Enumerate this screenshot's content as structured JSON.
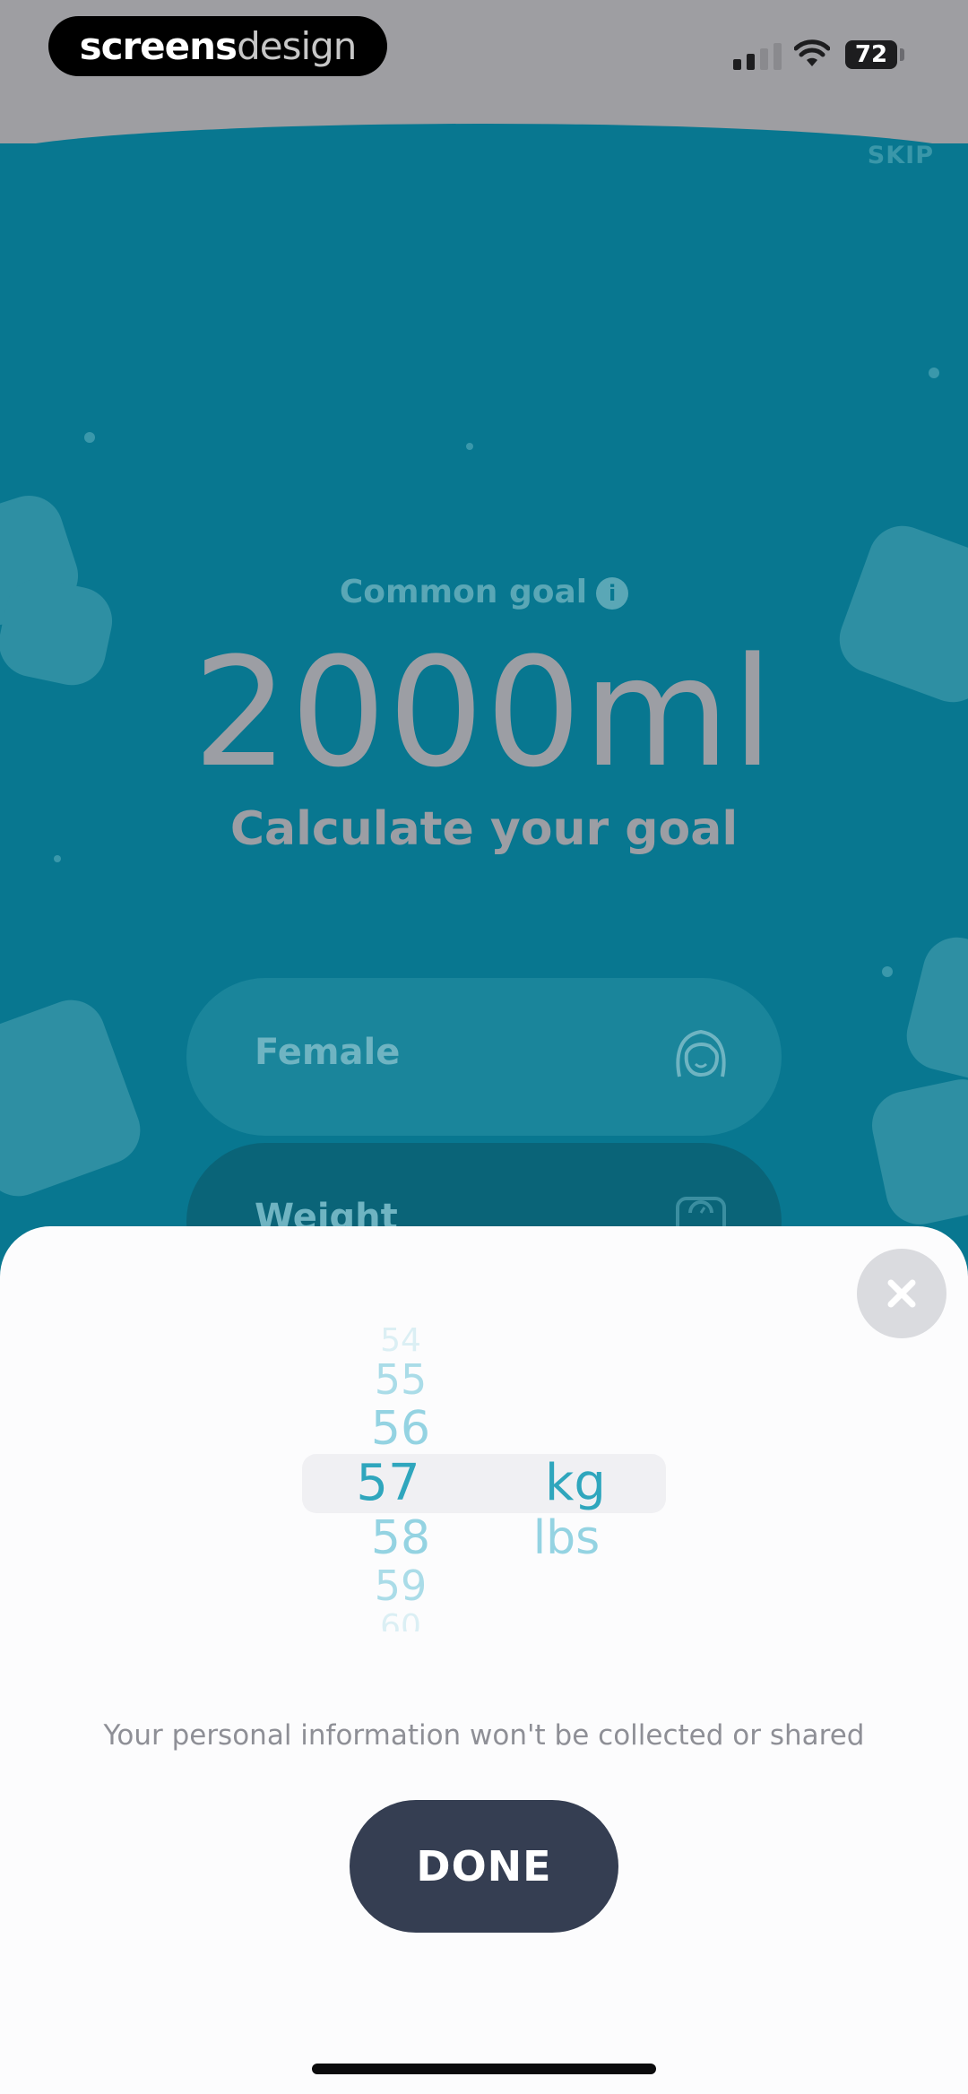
{
  "status_bar": {
    "brand_primary": "screens",
    "brand_secondary": "design",
    "battery": "72"
  },
  "header": {
    "skip_label": "SKIP"
  },
  "goal": {
    "common_label": "Common goal",
    "info_symbol": "i",
    "amount": "2000ml",
    "calculate_label": "Calculate your goal"
  },
  "form": {
    "gender_label": "Female",
    "weight_label": "Weight"
  },
  "picker": {
    "numbers": [
      "54",
      "55",
      "56",
      "57",
      "58",
      "59",
      "60"
    ],
    "selected_number": "57",
    "units": [
      "kg",
      "lbs"
    ],
    "selected_unit": "kg"
  },
  "sheet": {
    "privacy_note": "Your personal information won't be collected or shared",
    "done_label": "DONE"
  },
  "colors": {
    "teal_background": "#087790",
    "picker_accent": "#2fa6bd",
    "done_button": "#353e52"
  },
  "icons": [
    "signal-icon",
    "wifi-icon",
    "battery-icon",
    "info-icon",
    "female-face-icon",
    "scale-icon",
    "close-icon"
  ]
}
